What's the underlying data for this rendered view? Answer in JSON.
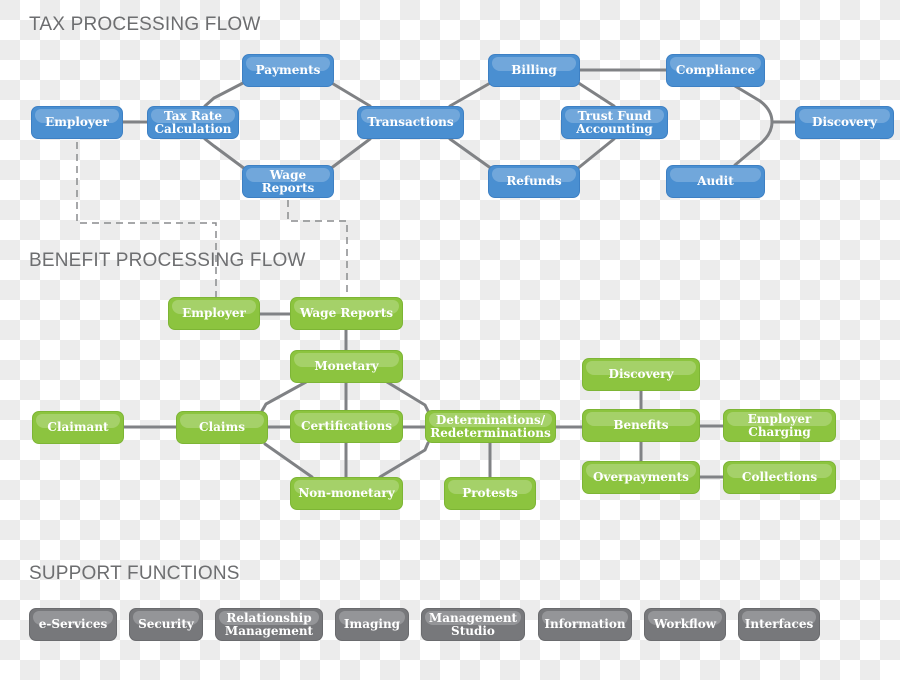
{
  "titles": {
    "tax": "TAX PROCESSING FLOW",
    "benefit": "BENEFIT PROCESSING FLOW",
    "support": "SUPPORT FUNCTIONS"
  },
  "colors": {
    "tax_node": "#4a8fd1",
    "benefit_node": "#8cc43f",
    "support_node": "#77787b",
    "connector": "#808285",
    "title_text": "#6d6e70"
  },
  "tax_flow": {
    "nodes": [
      {
        "id": "employer",
        "label": "Employer"
      },
      {
        "id": "tax_rate",
        "label": "Tax Rate\nCalculation"
      },
      {
        "id": "payments",
        "label": "Payments"
      },
      {
        "id": "wage_reports",
        "label": "Wage\nReports"
      },
      {
        "id": "transactions",
        "label": "Transactions"
      },
      {
        "id": "billing",
        "label": "Billing"
      },
      {
        "id": "refunds",
        "label": "Refunds"
      },
      {
        "id": "trust_fund",
        "label": "Trust Fund\nAccounting"
      },
      {
        "id": "compliance",
        "label": "Compliance"
      },
      {
        "id": "audit",
        "label": "Audit"
      },
      {
        "id": "discovery",
        "label": "Discovery"
      }
    ],
    "edges": [
      [
        "employer",
        "tax_rate"
      ],
      [
        "tax_rate",
        "payments"
      ],
      [
        "tax_rate",
        "wage_reports"
      ],
      [
        "payments",
        "transactions"
      ],
      [
        "wage_reports",
        "transactions"
      ],
      [
        "transactions",
        "billing"
      ],
      [
        "transactions",
        "refunds"
      ],
      [
        "billing",
        "trust_fund"
      ],
      [
        "refunds",
        "trust_fund"
      ],
      [
        "billing",
        "compliance"
      ],
      [
        "compliance",
        "discovery"
      ],
      [
        "audit",
        "discovery"
      ]
    ]
  },
  "cross_links": [
    {
      "from": "tax.employer",
      "to": "benefit.employer",
      "style": "dashed"
    },
    {
      "from": "tax.wage_reports",
      "to": "benefit.wage_reports",
      "style": "dashed"
    }
  ],
  "benefit_flow": {
    "nodes": [
      {
        "id": "employer",
        "label": "Employer"
      },
      {
        "id": "wage_reports",
        "label": "Wage Reports"
      },
      {
        "id": "monetary",
        "label": "Monetary"
      },
      {
        "id": "claimant",
        "label": "Claimant"
      },
      {
        "id": "claims",
        "label": "Claims"
      },
      {
        "id": "certifications",
        "label": "Certifications"
      },
      {
        "id": "non_monetary",
        "label": "Non-monetary"
      },
      {
        "id": "determinations",
        "label": "Determinations/\nRedeterminations"
      },
      {
        "id": "protests",
        "label": "Protests"
      },
      {
        "id": "discovery",
        "label": "Discovery"
      },
      {
        "id": "benefits",
        "label": "Benefits"
      },
      {
        "id": "overpayments",
        "label": "Overpayments"
      },
      {
        "id": "employer_charging",
        "label": "Employer\nCharging"
      },
      {
        "id": "collections",
        "label": "Collections"
      }
    ],
    "edges": [
      [
        "employer",
        "wage_reports"
      ],
      [
        "wage_reports",
        "monetary"
      ],
      [
        "monetary",
        "certifications"
      ],
      [
        "certifications",
        "non_monetary"
      ],
      [
        "claimant",
        "claims"
      ],
      [
        "claims",
        "certifications"
      ],
      [
        "claims",
        "monetary"
      ],
      [
        "claims",
        "non_monetary"
      ],
      [
        "monetary",
        "determinations"
      ],
      [
        "non_monetary",
        "determinations"
      ],
      [
        "certifications",
        "determinations"
      ],
      [
        "determinations",
        "protests"
      ],
      [
        "determinations",
        "benefits"
      ],
      [
        "discovery",
        "benefits"
      ],
      [
        "benefits",
        "overpayments"
      ],
      [
        "benefits",
        "employer_charging"
      ],
      [
        "overpayments",
        "collections"
      ]
    ]
  },
  "support_functions": [
    {
      "id": "e_services",
      "label": "e-Services"
    },
    {
      "id": "security",
      "label": "Security"
    },
    {
      "id": "relationship_management",
      "label": "Relationship\nManagement"
    },
    {
      "id": "imaging",
      "label": "Imaging"
    },
    {
      "id": "management_studio",
      "label": "Management\nStudio"
    },
    {
      "id": "information",
      "label": "Information"
    },
    {
      "id": "workflow",
      "label": "Workflow"
    },
    {
      "id": "interfaces",
      "label": "Interfaces"
    }
  ]
}
